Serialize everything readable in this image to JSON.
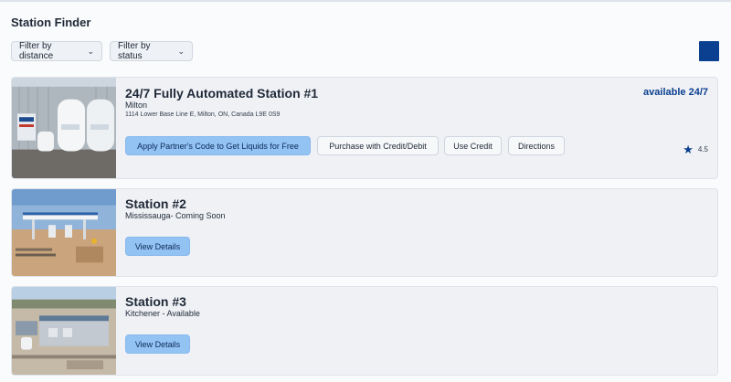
{
  "header": {
    "title": "Station Finder",
    "filters": [
      {
        "label": "Filter by distance"
      },
      {
        "label": "Filter by status"
      }
    ]
  },
  "colors": {
    "accent": "#0b3f8f",
    "primary_button": "#93c3f3",
    "card_bg": "#eff1f5"
  },
  "stations": [
    {
      "name": "24/7 Fully Automated Station  #1",
      "city": "Milton",
      "address": "1114 Lower Base Line E,  Milton, ON, Canada L9E 0S9",
      "availability": "available 24/7",
      "buttons": {
        "apply": "Apply  Partner's Code to Get Liquids for Free",
        "purchase": "Purchase with Credit/Debit",
        "use_credit": "Use Credit",
        "directions": "Directions"
      },
      "rating": "4.5"
    },
    {
      "name": "Station #2",
      "city": "Mississauga- Coming Soon",
      "buttons": {
        "details": "View Details"
      }
    },
    {
      "name": "Station #3",
      "city": "Kitchener - Available",
      "buttons": {
        "details": "View Details"
      }
    }
  ]
}
